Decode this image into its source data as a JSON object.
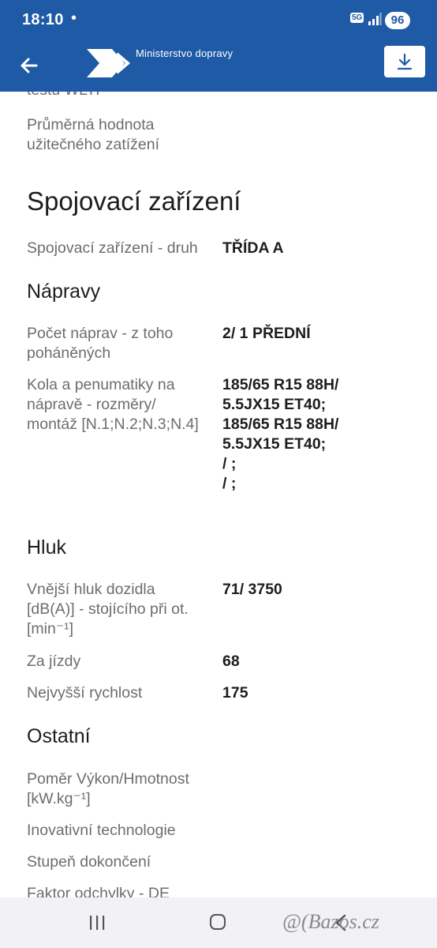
{
  "status": {
    "time": "18:10",
    "dot": "•",
    "network": "5G",
    "battery": "96"
  },
  "app": {
    "brand": "Ministerstvo dopravy"
  },
  "content": {
    "cut_label": "testu WLTP",
    "average_payload_label": [
      "Průměrná hodnota",
      "užitečného zatížení"
    ],
    "coupling_heading": "Spojovací zařízení",
    "coupling_type_label": "Spojovací zařízení - druh",
    "coupling_type_value": "TŘÍDA A",
    "axles_heading": "Nápravy",
    "axle_count_label": [
      "Počet náprav - z toho",
      "poháněných"
    ],
    "axle_count_value": "2/ 1 PŘEDNÍ",
    "wheels_label": [
      "Kola a penumatiky na",
      "nápravě - rozměry/",
      "montáž [N.1;N.2;N.3;N.4]"
    ],
    "wheels_value": [
      "185/65 R15 88H/",
      "5.5JX15 ET40;",
      "185/65 R15 88H/",
      "5.5JX15 ET40;",
      "/ ;",
      "/ ;"
    ],
    "noise_heading": "Hluk",
    "standing_noise_label": [
      "Vnější hluk dozidla",
      "[dB(A)] - stojícího při ot.",
      "[min⁻¹]"
    ],
    "standing_noise_value": "71/ 3750",
    "driving_noise_label": "Za jízdy",
    "driving_noise_value": "68",
    "max_speed_label": "Nejvyšší rychlost",
    "max_speed_value": "175",
    "other_heading": "Ostatní",
    "power_ratio_label": [
      "Poměr Výkon/Hmotnost",
      "[kW.kg⁻¹]"
    ],
    "innovative_label": "Inovativní technologie",
    "completion_label": "Stupeň dokončení",
    "deviation_label": "Faktor odchylky - DE"
  },
  "watermark": "@(Bazos.cz",
  "icons": {
    "back": "arrow-left-icon",
    "download": "download-icon",
    "logo": "ministry-logo",
    "nav_recent": "recent-apps-icon",
    "nav_home": "home-icon",
    "nav_back": "nav-back-icon"
  },
  "colors": {
    "primary": "#1f5aa6",
    "label": "#6d6d72",
    "value": "#1d1d1f",
    "navbar": "#f2f2f6"
  }
}
